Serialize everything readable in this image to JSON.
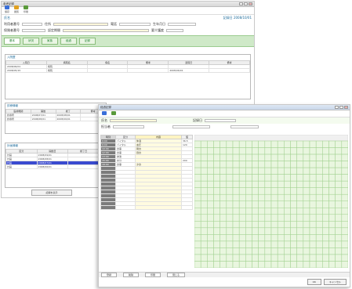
{
  "back_window": {
    "title": "参考記録",
    "toolbar": [
      {
        "label": "保存",
        "icon": "save-icon",
        "color": "#3a6fd8"
      },
      {
        "label": "閲覧",
        "icon": "view-icon",
        "color": "#e0a020"
      },
      {
        "label": "印刷",
        "icon": "print-icon",
        "color": "#5a9a3a"
      }
    ],
    "header_left": "氏名",
    "header_right": "記録日 2008/10/01",
    "fields": {
      "row1": [
        "利用者番号",
        "住所",
        "電話",
        "生年月日"
      ],
      "row2": [
        "保険者番号",
        "認定期間",
        "要介護度"
      ]
    },
    "tabs": [
      "基本",
      "状況",
      "家族",
      "経過",
      "記録"
    ],
    "section1": {
      "title": "入院歴",
      "headers": [
        "入院日",
        "病院名",
        "病名",
        "備考",
        "退院日",
        "備考"
      ],
      "rows": [
        [
          "2008/06/01",
          "病院",
          "",
          "",
          "",
          ""
        ],
        [
          "2008/05/15",
          "病院",
          "",
          "",
          "2008/06/01",
          ""
        ]
      ]
    },
    "section2": {
      "title": "診療情報",
      "headers": [
        "医療機関",
        "開始",
        "終了",
        "備考"
      ],
      "rows": [
        [
          "診療所",
          "2008/07/01",
          "2008/08/01",
          ""
        ],
        [
          "診療所",
          "2008/08/01",
          "2008/09/01",
          ""
        ]
      ]
    },
    "section3": {
      "title": "計画情報",
      "headers": [
        "区分",
        "開始日",
        "終了日"
      ],
      "rows": [
        [
          "計画",
          "2008/09/01",
          ""
        ],
        [
          "計画",
          "2008/08/01",
          ""
        ],
        [
          "計画",
          "2008/07/01",
          ""
        ],
        [
          "計画",
          "2008/06/01",
          ""
        ]
      ],
      "selected_index": 2
    },
    "bottom_button": "記録を表示"
  },
  "front_window": {
    "title": "経過記録",
    "fields_row1": [
      "氏名",
      "記録日"
    ],
    "fields_row2": [
      "担当者"
    ],
    "left_headers": [
      "時刻",
      "区分",
      "内容",
      "値"
    ],
    "left_rows": [
      [
        "9:00",
        "バイタル",
        "体温",
        "36.5"
      ],
      [
        "9:00",
        "バイタル",
        "血圧",
        "120"
      ],
      [
        "10:00",
        "食事",
        "朝食",
        ""
      ],
      [
        "12:00",
        "食事",
        "昼食",
        ""
      ],
      [
        "13:00",
        "排泄",
        "",
        ""
      ],
      [
        "15:00",
        "水分",
        "",
        "200"
      ],
      [
        "18:00",
        "食事",
        "夕食",
        ""
      ],
      [
        "",
        "",
        "",
        ""
      ],
      [
        "",
        "",
        "",
        ""
      ],
      [
        "",
        "",
        "",
        ""
      ],
      [
        "",
        "",
        "",
        ""
      ],
      [
        "",
        "",
        "",
        ""
      ],
      [
        "",
        "",
        "",
        ""
      ],
      [
        "",
        "",
        "",
        ""
      ],
      [
        "",
        "",
        "",
        ""
      ],
      [
        "",
        "",
        "",
        ""
      ],
      [
        "",
        "",
        "",
        ""
      ],
      [
        "",
        "",
        "",
        ""
      ]
    ],
    "status": [
      "登録",
      "削除",
      "印刷",
      "閉じる"
    ],
    "bottom_buttons": [
      "OK",
      "キャンセル"
    ],
    "accent": "#cfe9c8"
  }
}
